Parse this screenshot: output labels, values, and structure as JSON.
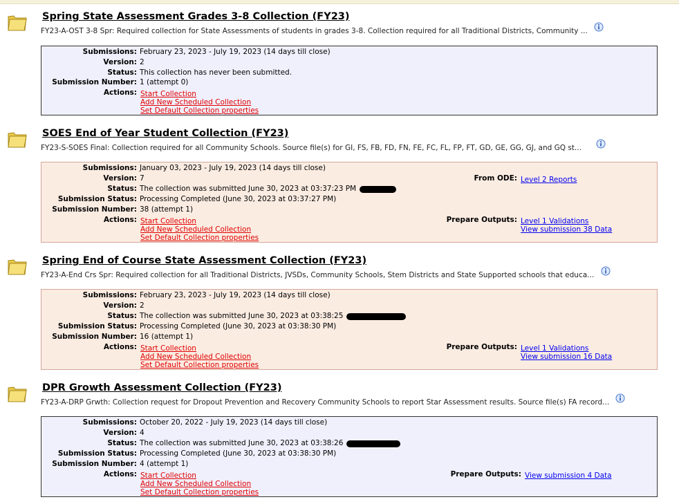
{
  "labels": {
    "submissions": "Submissions:",
    "version": "Version:",
    "status": "Status:",
    "submission_status": "Submission Status:",
    "submission_number": "Submission Number:",
    "actions": "Actions:",
    "from_ode": "From ODE:",
    "prepare_outputs": "Prepare Outputs:"
  },
  "actions": {
    "start": "Start Collection",
    "add_scheduled": "Add New Scheduled Collection",
    "set_default": "Set Default Collection properties"
  },
  "colors": {
    "blue_box": "#f0f0fc",
    "peach_box": "#fbece2",
    "action_link": "#e00000",
    "output_link": "#0000ee"
  },
  "collections": [
    {
      "title": "Spring State Assessment Grades 3-8 Collection (FY23)",
      "description": "FY23-A-OST 3-8 Spr: Required collection for State Assessments of students in grades 3-8. Collection required for all Traditional Districts, Community ...",
      "submissions": "February 23, 2023 - July 19, 2023 (14 days till close)",
      "version": "2",
      "status": "This collection has never been submitted.",
      "submission_number": "1 (attempt 0)"
    },
    {
      "title": "SOES End of Year Student Collection (FY23)",
      "description": "FY23-S-SOES Final: Collection required for all Community Schools. Source file(s) for GI, FS, FB, FD, FN, FE, FC, FL, FP, FT, GD, GE, GG, GJ, and GQ st...",
      "submissions": "January 03, 2023 - July 19, 2023 (14 days till close)",
      "version": "7",
      "status": "The collection was submitted June 30, 2023 at 03:37:23 PM",
      "submission_status": "Processing Completed (June 30, 2023 at 03:37:27 PM)",
      "submission_number": "38 (attempt 1)",
      "from_ode_link": "Level 2 Reports",
      "output_links": [
        "Level 1 Validations",
        "View submission 38 Data"
      ]
    },
    {
      "title": "Spring End of Course State Assessment Collection (FY23)",
      "description": "FY23-A-End Crs Spr: Required collection for all Traditional Districts, JVSDs, Community Schools, Stem Districts and State Supported schools that educa...",
      "submissions": "February 23, 2023 - July 19, 2023 (14 days till close)",
      "version": "2",
      "status": "The collection was submitted June 30, 2023 at 03:38:25",
      "submission_status": "Processing Completed (June 30, 2023 at 03:38:30 PM)",
      "submission_number": "16 (attempt 1)",
      "output_links": [
        "Level 1 Validations",
        "View submission 16 Data"
      ]
    },
    {
      "title": "DPR Growth Assessment Collection (FY23)",
      "description": "FY23-A-DRP Grwth: Collection request for Dropout Prevention and Recovery Community Schools to report Star Assessment results. Source file(s) FA record...",
      "submissions": "October 20, 2022 - July 19, 2023 (14 days till close)",
      "version": "4",
      "status": "The collection was submitted June 30, 2023 at 03:38:26",
      "submission_status": "Processing Completed (June 30, 2023 at 03:38:30 PM)",
      "submission_number": "4 (attempt 1)",
      "output_links": [
        "View submission 4 Data"
      ]
    }
  ]
}
